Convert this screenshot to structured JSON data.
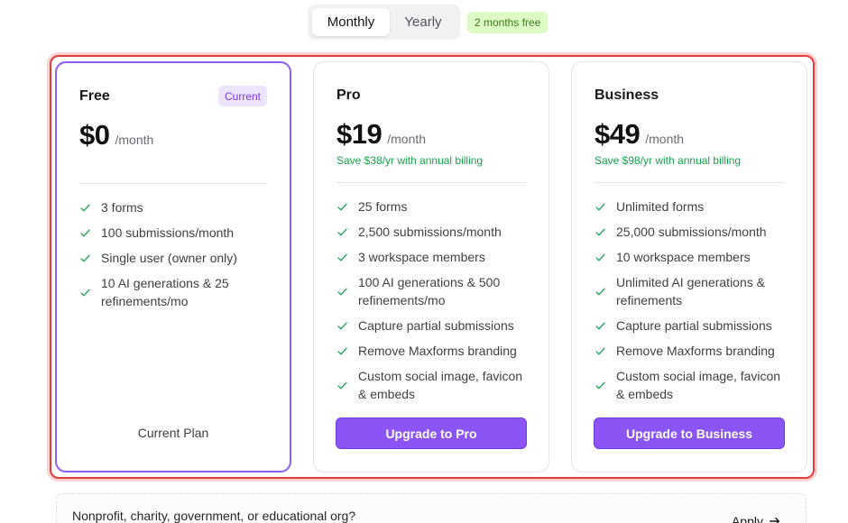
{
  "billing": {
    "options": [
      {
        "label": "Monthly",
        "selected": true
      },
      {
        "label": "Yearly",
        "selected": false
      }
    ],
    "yearly_badge": "2 months free"
  },
  "plans": [
    {
      "name": "Free",
      "badge": "Current",
      "price": "$0",
      "period": "/month",
      "save_note": "",
      "features": [
        "3 forms",
        "100 submissions/month",
        "Single user (owner only)",
        "10 AI generations & 25 refinements/mo"
      ],
      "action_label": "Current Plan"
    },
    {
      "name": "Pro",
      "price": "$19",
      "period": "/month",
      "save_note": "Save $38/yr with annual billing",
      "features": [
        "25 forms",
        "2,500 submissions/month",
        "3 workspace members",
        "100 AI generations & 500 refinements/mo",
        "Capture partial submissions",
        "Remove Maxforms branding",
        "Custom social image, favicon & embeds"
      ],
      "action_label": "Upgrade to Pro"
    },
    {
      "name": "Business",
      "price": "$49",
      "period": "/month",
      "save_note": "Save $98/yr with annual billing",
      "features": [
        "Unlimited forms",
        "25,000 submissions/month",
        "10 workspace members",
        "Unlimited AI generations & refinements",
        "Capture partial submissions",
        "Remove Maxforms branding",
        "Custom social image, favicon & embeds"
      ],
      "action_label": "Upgrade to Business"
    }
  ],
  "nonprofit": {
    "text": "Nonprofit, charity, government, or educational org?",
    "apply_label": "Apply"
  },
  "colors": {
    "accent": "#8b55f6",
    "success": "#22a35a",
    "highlight": "#ea3a3a"
  },
  "icons": {
    "feature": "check-icon",
    "apply": "arrow-right-icon"
  }
}
